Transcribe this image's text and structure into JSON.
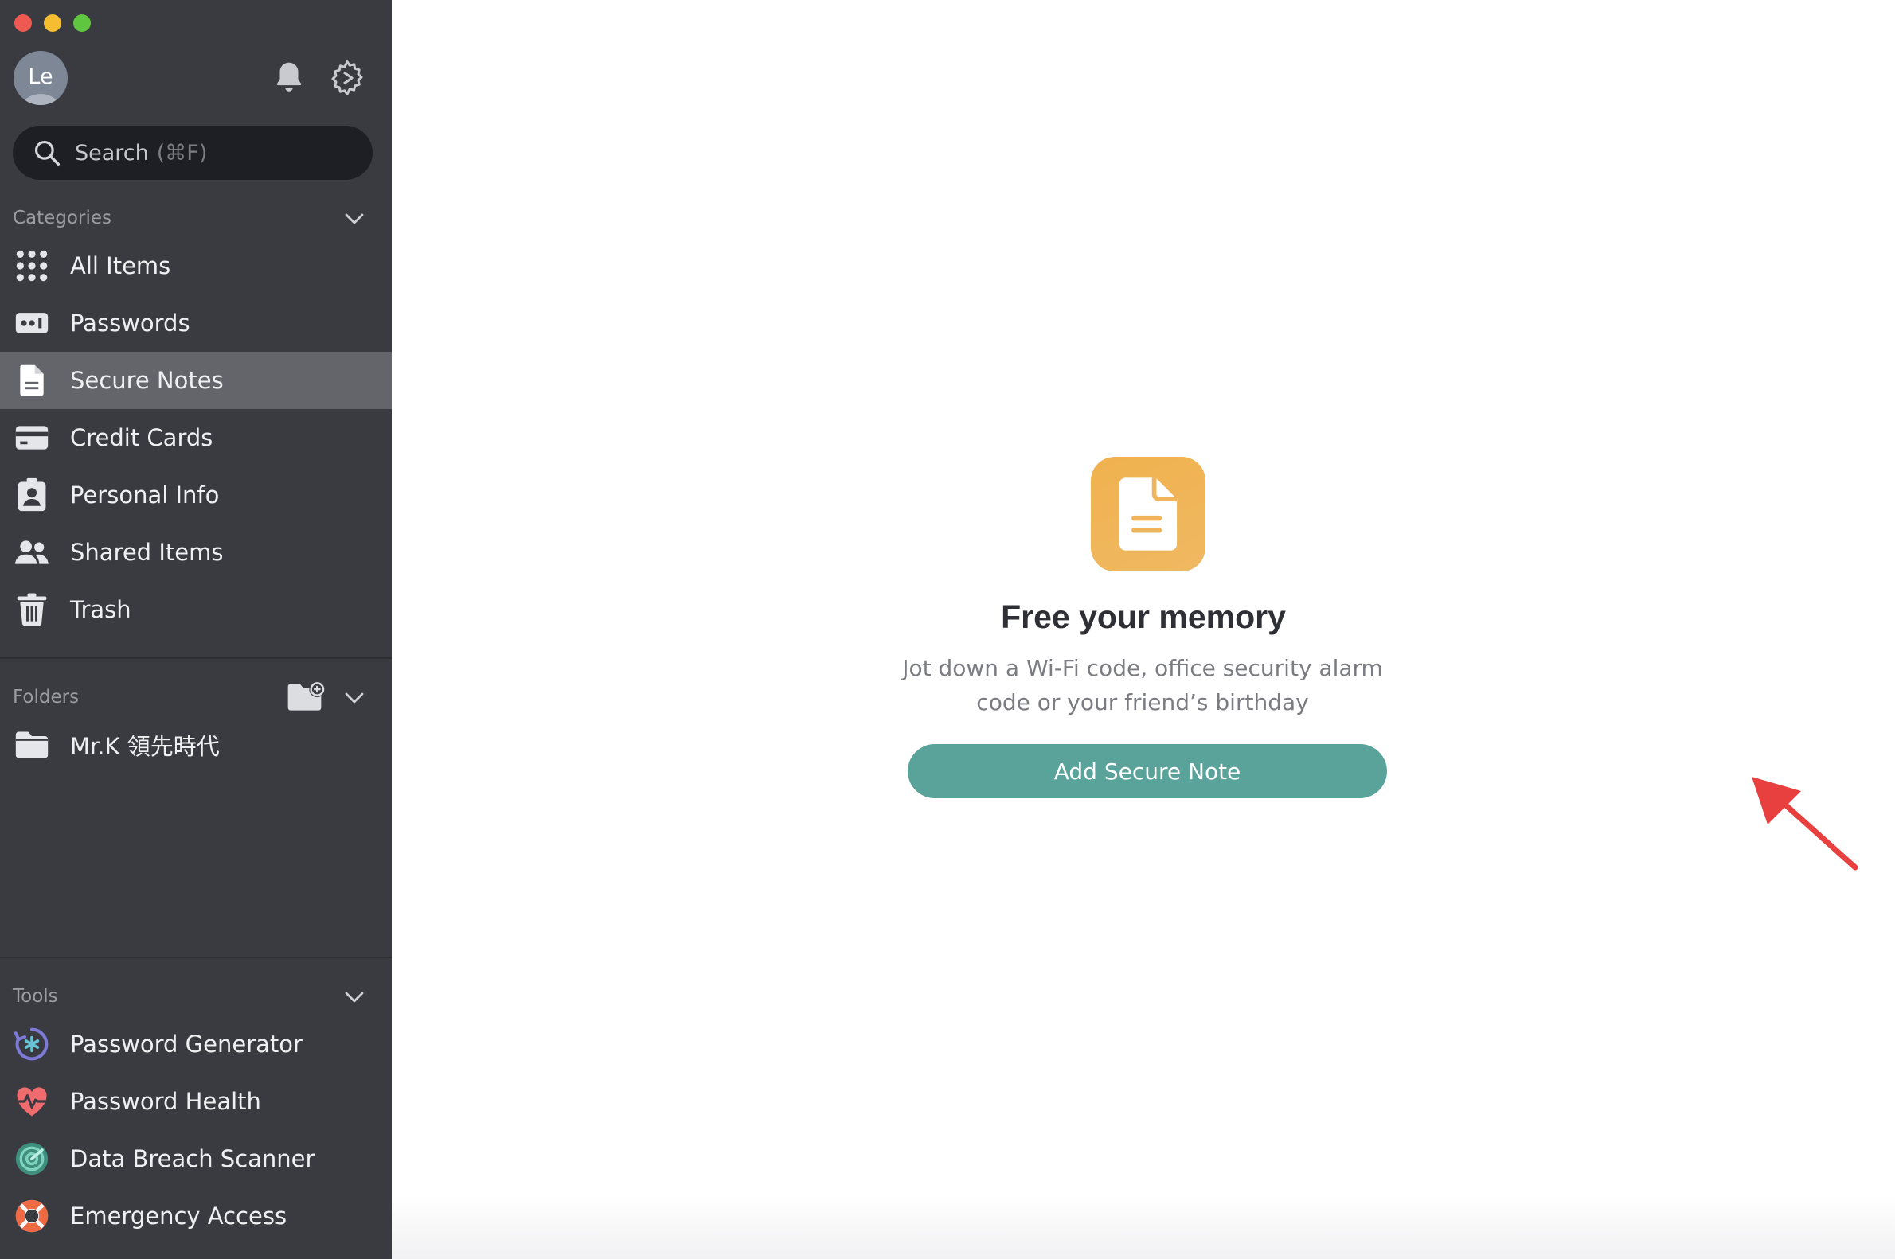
{
  "avatar": {
    "initials": "Le"
  },
  "search": {
    "label": "Search",
    "shortcut": "(⌘F)"
  },
  "categories": {
    "header": "Categories",
    "items": [
      {
        "label": "All Items",
        "icon": "grid-icon"
      },
      {
        "label": "Passwords",
        "icon": "password-icon"
      },
      {
        "label": "Secure Notes",
        "icon": "note-icon",
        "active": true
      },
      {
        "label": "Credit Cards",
        "icon": "credit-card-icon"
      },
      {
        "label": "Personal Info",
        "icon": "id-card-icon"
      },
      {
        "label": "Shared Items",
        "icon": "people-icon"
      },
      {
        "label": "Trash",
        "icon": "trash-icon"
      }
    ]
  },
  "folders": {
    "header": "Folders",
    "items": [
      {
        "label": "Mr.K 領先時代",
        "icon": "folder-icon"
      }
    ]
  },
  "tools": {
    "header": "Tools",
    "items": [
      {
        "label": "Password Generator",
        "icon": "password-generator-icon"
      },
      {
        "label": "Password Health",
        "icon": "heart-pulse-icon"
      },
      {
        "label": "Data Breach Scanner",
        "icon": "radar-icon"
      },
      {
        "label": "Emergency Access",
        "icon": "lifebuoy-icon"
      }
    ]
  },
  "empty_state": {
    "title": "Free your memory",
    "description_line1": "Jot down a Wi-Fi code, office security alarm",
    "description_line2": "code or your friend’s birthday",
    "button_label": "Add Secure Note"
  },
  "colors": {
    "sidebar_bg": "#3a3b40",
    "active_item_bg": "#64656a",
    "accent_button": "#5aa39b",
    "note_badge": "#f0b45a",
    "annotation_arrow": "#e8403f"
  }
}
